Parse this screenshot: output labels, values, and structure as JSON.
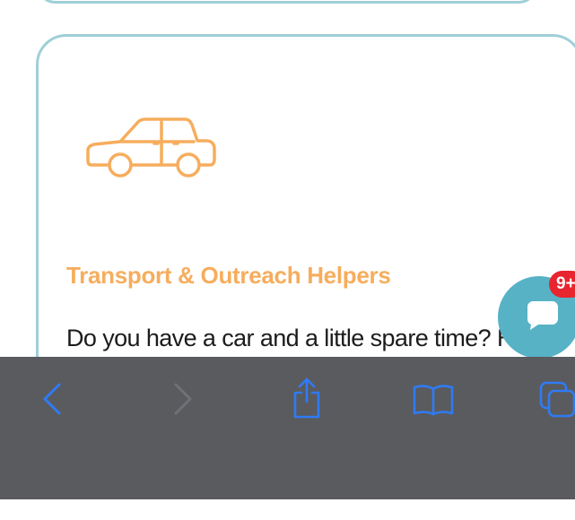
{
  "card": {
    "title": "Transport & Outreach Helpers",
    "body": "Do you have a car and a little spare time? Help pet families get to their spay/neuter or",
    "icon": "car-icon"
  },
  "chat": {
    "icon": "chat-bubble-icon",
    "badge": "9+"
  },
  "toolbar": {
    "back_icon": "chevron-left-icon",
    "forward_icon": "chevron-right-icon",
    "share_icon": "share-icon",
    "bookmarks_icon": "book-icon",
    "tabs_icon": "tabs-icon"
  },
  "colors": {
    "accent": "#f6ad5d",
    "card_border": "#9fcfd8",
    "chat_button": "#57b2c6",
    "badge": "#e8242f",
    "toolbar_bg": "#5a5b5e",
    "toolbar_icon": "#2f7bf5"
  }
}
